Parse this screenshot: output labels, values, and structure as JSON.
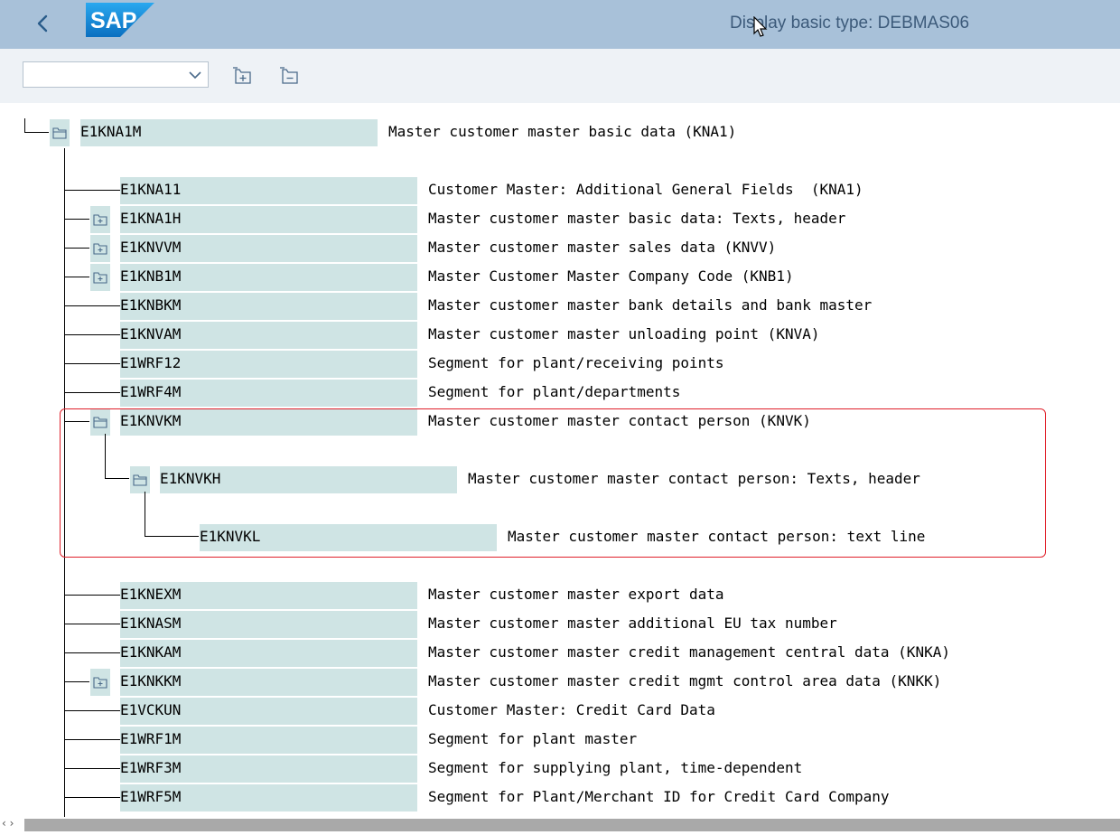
{
  "window": {
    "title": "Display basic type: DEBMAS06",
    "logo_text": "SAP"
  },
  "toolbar": {
    "dropdown_value": "",
    "expand_icon": "expand-subtree-icon",
    "collapse_icon": "collapse-subtree-icon"
  },
  "tree": {
    "root": {
      "name": "E1KNA1M",
      "desc": "Master customer master basic data (KNA1)"
    },
    "children": [
      {
        "name": "E1KNA11",
        "desc": "Customer Master: Additional General Fields  (KNA1)",
        "folder": "none"
      },
      {
        "name": "E1KNA1H",
        "desc": "Master customer master basic data: Texts, header",
        "folder": "closed"
      },
      {
        "name": "E1KNVVM",
        "desc": "Master customer master sales data (KNVV)",
        "folder": "closed"
      },
      {
        "name": "E1KNB1M",
        "desc": "Master Customer Master Company Code (KNB1)",
        "folder": "closed"
      },
      {
        "name": "E1KNBKM",
        "desc": "Master customer master bank details and bank master",
        "folder": "none"
      },
      {
        "name": "E1KNVAM",
        "desc": "Master customer master unloading point (KNVA)",
        "folder": "none"
      },
      {
        "name": "E1WRF12",
        "desc": "Segment for plant/receiving points",
        "folder": "none"
      },
      {
        "name": "E1WRF4M",
        "desc": "Segment for plant/departments",
        "folder": "none"
      },
      {
        "name": "E1KNVKM",
        "desc": "Master customer master contact person (KNVK)",
        "folder": "open"
      },
      {
        "name": "E1KNEXM",
        "desc": "Master customer master export data",
        "folder": "none"
      },
      {
        "name": "E1KNASM",
        "desc": "Master customer master additional EU tax number",
        "folder": "none"
      },
      {
        "name": "E1KNKAM",
        "desc": "Master customer master credit management central data (KNKA)",
        "folder": "none"
      },
      {
        "name": "E1KNKKM",
        "desc": "Master customer master credit mgmt control area data (KNKK)",
        "folder": "closed"
      },
      {
        "name": "E1VCKUN",
        "desc": "Customer Master: Credit Card Data",
        "folder": "none"
      },
      {
        "name": "E1WRF1M",
        "desc": "Segment for plant master",
        "folder": "none"
      },
      {
        "name": "E1WRF3M",
        "desc": "Segment for supplying plant, time-dependent",
        "folder": "none"
      },
      {
        "name": "E1WRF5M",
        "desc": "Segment for Plant/Merchant ID for Credit Card Company",
        "folder": "none"
      }
    ],
    "knvkh": {
      "name": "E1KNVKH",
      "desc": "Master customer master contact person: Texts, header"
    },
    "knvkl": {
      "name": "E1KNVKL",
      "desc": "Master customer master contact person: text line"
    }
  },
  "colors": {
    "titlebar": "#a8c1d9",
    "node_bg": "#cfe4e4",
    "highlight": "#e0202a",
    "logo": "#1a8fd9"
  }
}
